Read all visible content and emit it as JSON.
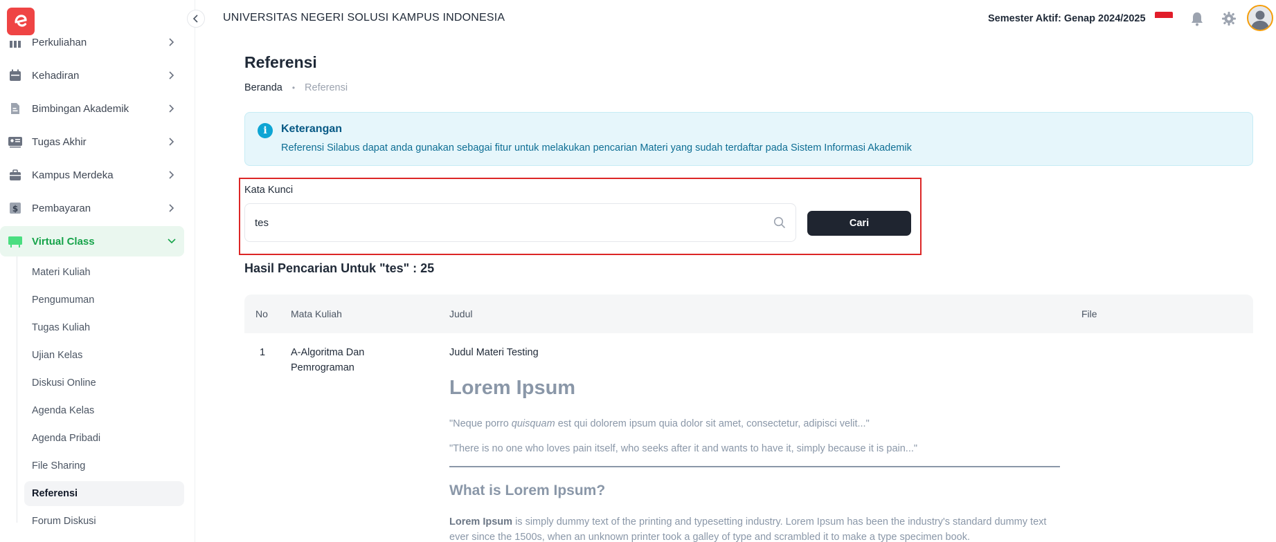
{
  "app": {
    "logo_letter": "e",
    "university": "UNIVERSITAS NEGERI SOLUSI KAMPUS INDONESIA",
    "semester": "Semester Aktif: Genap 2024/2025"
  },
  "sidebar": {
    "items": [
      {
        "label": "Perkuliahan",
        "icon": "columns-icon"
      },
      {
        "label": "Kehadiran",
        "icon": "calendar-icon"
      },
      {
        "label": "Bimbingan Akademik",
        "icon": "document-icon"
      },
      {
        "label": "Tugas Akhir",
        "icon": "id-card-icon"
      },
      {
        "label": "Kampus Merdeka",
        "icon": "briefcase-icon"
      },
      {
        "label": "Pembayaran",
        "icon": "dollar-icon"
      },
      {
        "label": "Virtual Class",
        "icon": "board-icon"
      }
    ],
    "sub_items": [
      "Materi Kuliah",
      "Pengumuman",
      "Tugas Kuliah",
      "Ujian Kelas",
      "Diskusi Online",
      "Agenda Kelas",
      "Agenda Pribadi",
      "File Sharing",
      "Referensi",
      "Forum Diskusi"
    ],
    "selected_sub": "Referensi"
  },
  "page": {
    "title": "Referensi",
    "breadcrumb": {
      "home": "Beranda",
      "separator": "•",
      "current": "Referensi"
    }
  },
  "info": {
    "title": "Keterangan",
    "text": "Referensi Silabus dapat anda gunakan sebagai fitur untuk melakukan pencarian Materi yang sudah terdaftar pada Sistem Informasi Akademik",
    "icon_glyph": "i"
  },
  "search": {
    "label": "Kata Kunci",
    "value": "tes",
    "button": "Cari"
  },
  "results": {
    "title": "Hasil Pencarian Untuk \"tes\" : 25"
  },
  "table": {
    "columns": [
      "No",
      "Mata Kuliah",
      "Judul",
      "File"
    ],
    "rows": [
      {
        "no": "1",
        "mata_kuliah": "A-Algoritma Dan Pemrograman",
        "judul": "Judul Materi Testing"
      }
    ]
  },
  "content_preview": {
    "h1": "Lorem Ipsum",
    "quote1_prefix": "\"Neque porro ",
    "quote1_em": "quisquam",
    "quote1_suffix": " est qui dolorem ipsum quia dolor sit amet, consectetur, adipisci velit...\"",
    "quote2": "\"There is no one who loves pain itself, who seeks after it and wants to have it, simply because it is pain...\"",
    "h2": "What is Lorem Ipsum?",
    "p_bold": "Lorem Ipsum",
    "p_text": " is simply dummy text of the printing and typesetting industry. Lorem Ipsum has been the industry's standard dummy text ever since the 1500s, when an unknown printer took a galley of type and scrambled it to make a type specimen book."
  },
  "colors": {
    "brand": "#ef4444",
    "active_green": "#16a34a",
    "info_bg": "#e6f6fb",
    "highlight_border": "#dc2626",
    "button_dark": "#1f2530"
  }
}
